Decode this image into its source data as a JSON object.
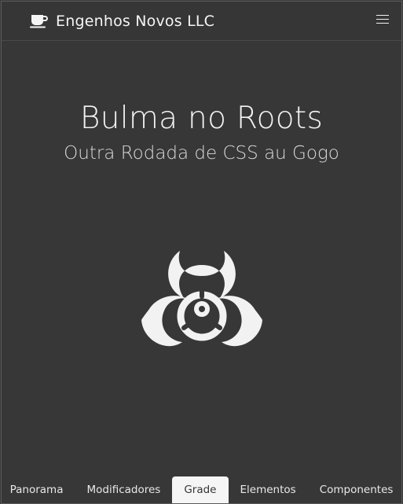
{
  "navbar": {
    "brand_icon": "coffee-cup-icon",
    "brand_name": "Engenhos Novos LLC",
    "menu_icon": "hamburger-menu-icon"
  },
  "hero": {
    "title": "Bulma no Roots",
    "subtitle": "Outra Rodada de CSS au Gogo",
    "icon": "biohazard-icon"
  },
  "tabs": [
    {
      "label": "Panorama",
      "active": false
    },
    {
      "label": "Modificadores",
      "active": false
    },
    {
      "label": "Grade",
      "active": true
    },
    {
      "label": "Elementos",
      "active": false
    },
    {
      "label": "Componentes",
      "active": false
    }
  ],
  "colors": {
    "background": "#373737",
    "text": "#f5f5f5",
    "active_tab_bg": "#f5f5f5",
    "active_tab_text": "#363636"
  }
}
